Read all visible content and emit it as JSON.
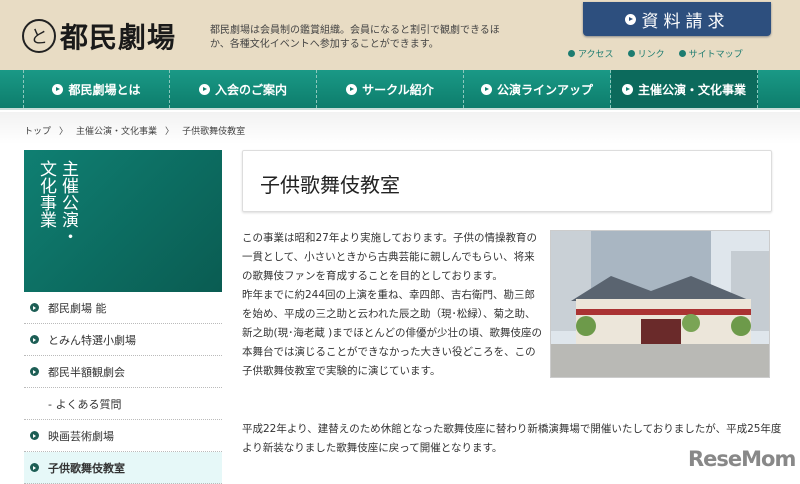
{
  "header": {
    "logo_mark": "と",
    "logo_text": "都民劇場",
    "tagline": "都民劇場は会員制の鑑賞組織。会員になると割引で観劇できるほか、各種文化イベントへ参加することができます。",
    "request_button": "資料請求",
    "links": [
      "アクセス",
      "リンク",
      "サイトマップ"
    ]
  },
  "nav": [
    "都民劇場とは",
    "入会のご案内",
    "サークル紹介",
    "公演ラインアップ",
    "主催公演・文化事業"
  ],
  "breadcrumb": [
    "トップ",
    "主催公演・文化事業",
    "子供歌舞伎教室"
  ],
  "breadcrumb_sep": "〉",
  "sidebar": {
    "heading_col1": "主催公演・",
    "heading_col2": "文化事業",
    "items": [
      "都民劇場 能",
      "とみん特選小劇場",
      "都民半額観劇会",
      "- よくある質問",
      "映画芸術劇場",
      "子供歌舞伎教室"
    ]
  },
  "main": {
    "title": "子供歌舞伎教室",
    "para1": "この事業は昭和27年より実施しております。子供の情操教育の一貫として、小さいときから古典芸能に親しんでもらい、将来の歌舞伎ファンを育成することを目的としております。",
    "para1b": "昨年までに約244回の上演を重ね、幸四郎、吉右衛門、勘三郎を始め、平成の三之助と云われた辰之助（現･松緑）、菊之助、新之助(現･海老蔵 )までほとんどの俳優が少壮の頃、歌舞伎座の本舞台では演じることができなかった大きい役どころを、この子供歌舞伎教室で実験的に演じています。",
    "para2": "平成22年より、建替えのため休館となった歌舞伎座に替わり新橋演舞場で開催いたしておりましたが、平成25年度より新装なりました歌舞伎座に戻って開催となります。"
  },
  "watermark": "ReseMom",
  "colors": {
    "teal": "#0f8a78",
    "navy": "#2d4f7e",
    "beige": "#e8dcc4"
  }
}
